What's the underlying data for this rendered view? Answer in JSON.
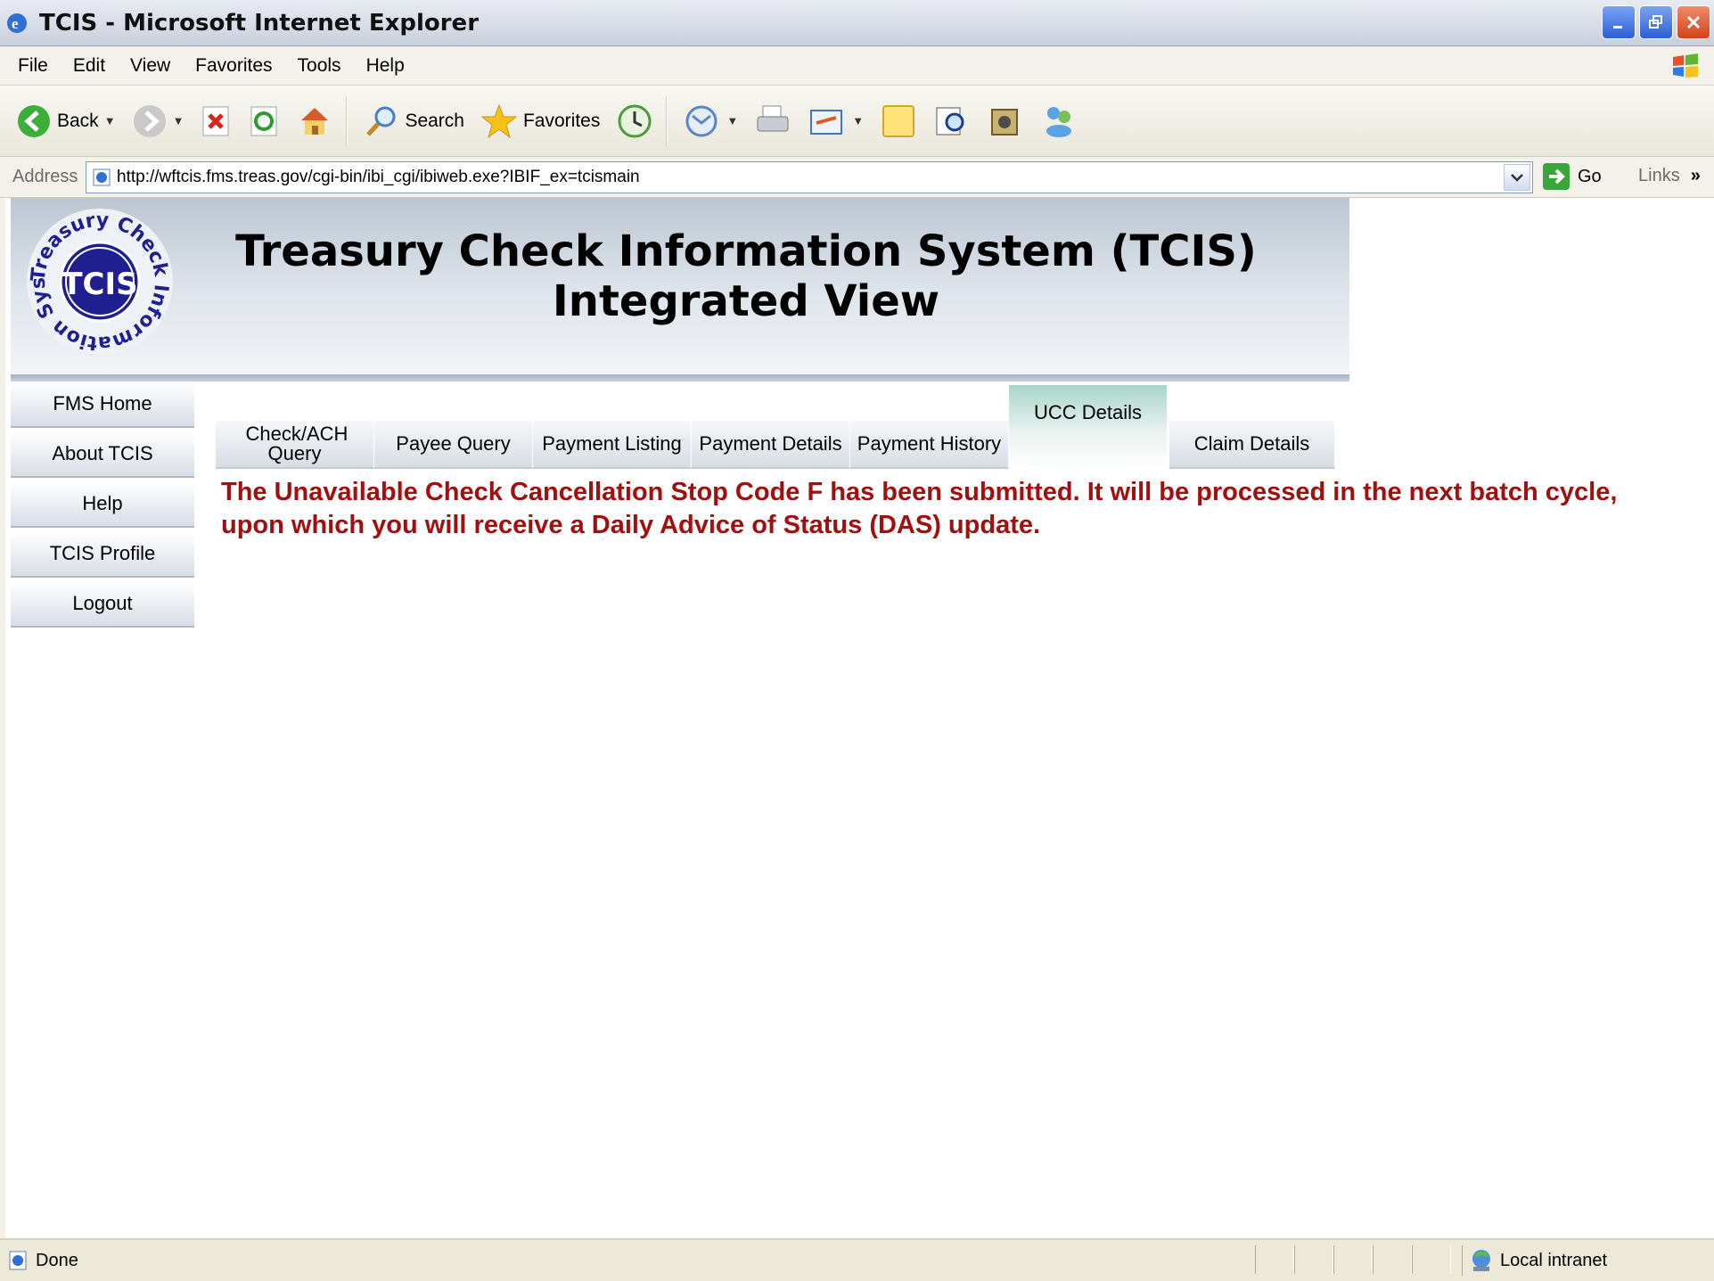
{
  "window": {
    "title": "TCIS - Microsoft Internet Explorer"
  },
  "menu": {
    "items": [
      "File",
      "Edit",
      "View",
      "Favorites",
      "Tools",
      "Help"
    ]
  },
  "toolbar": {
    "back_label": "Back",
    "search_label": "Search",
    "favorites_label": "Favorites"
  },
  "address": {
    "label": "Address",
    "url": "http://wftcis.fms.treas.gov/cgi-bin/ibi_cgi/ibiweb.exe?IBIF_ex=tcismain",
    "go_label": "Go",
    "links_label": "Links"
  },
  "banner": {
    "title_line1": "Treasury Check Information System (TCIS)",
    "title_line2": "Integrated View",
    "logo_text": "TCIS",
    "logo_ring_text": "Treasury Check Information System"
  },
  "nav": {
    "items": [
      {
        "label": "FMS Home"
      },
      {
        "label": "About TCIS"
      },
      {
        "label": "Help"
      },
      {
        "label": "TCIS Profile"
      },
      {
        "label": "Logout"
      }
    ]
  },
  "tabs": [
    {
      "label": "Check/ACH Query",
      "active": false
    },
    {
      "label": "Payee Query",
      "active": false
    },
    {
      "label": "Payment Listing",
      "active": false
    },
    {
      "label": "Payment Details",
      "active": false
    },
    {
      "label": "Payment History",
      "active": false
    },
    {
      "label": "UCC Details",
      "active": true
    },
    {
      "label": "Claim Details",
      "active": false
    }
  ],
  "message": "The Unavailable Check Cancellation Stop Code F has been submitted. It will be processed in the next batch cycle, upon which you will receive a Daily Advice of Status (DAS) update.",
  "status": {
    "text": "Done",
    "zone": "Local intranet"
  },
  "colors": {
    "message": "#a20f0f",
    "active_tab": "#a9d4c9",
    "logo_blue": "#1f1f8f"
  }
}
